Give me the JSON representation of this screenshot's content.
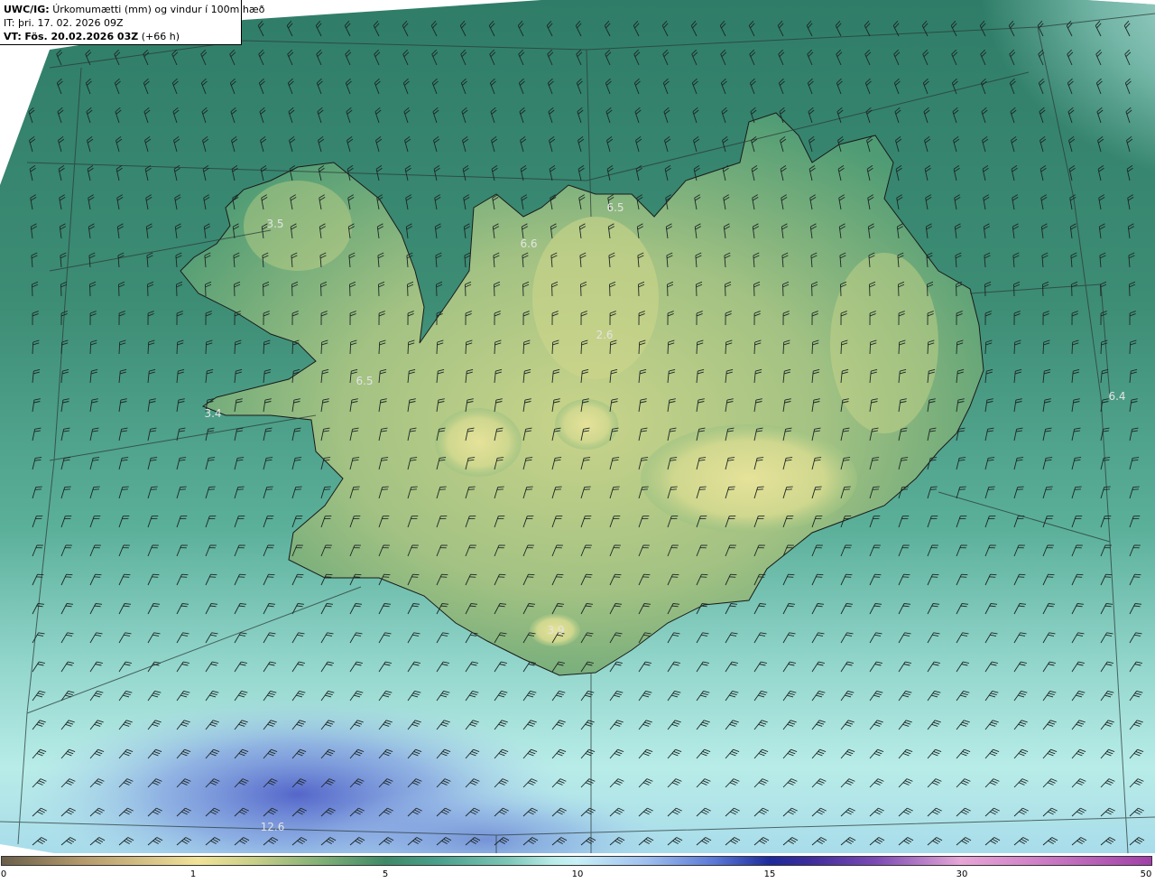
{
  "header": {
    "model": "UWC/IG:",
    "field": "Úrkomumætti (mm) og vindur í 100m hæð",
    "init_time": "IT: þri. 17. 02. 2026 09Z",
    "valid_prefix": "VT:",
    "valid_time": "Fös. 20.02.2026 03Z",
    "lead": "(+66 h)"
  },
  "map_labels": [
    {
      "text": "3.5",
      "id": "westfjords"
    },
    {
      "text": "6.6",
      "id": "north-west"
    },
    {
      "text": "6.5",
      "id": "north"
    },
    {
      "text": "2.6",
      "id": "central-north"
    },
    {
      "text": "6.5",
      "id": "west"
    },
    {
      "text": "3.4",
      "id": "snaefellsnes"
    },
    {
      "text": "6.4",
      "id": "east-sea"
    },
    {
      "text": "3.9",
      "id": "south"
    },
    {
      "text": "12.6",
      "id": "south-sea"
    }
  ],
  "colorbar": {
    "ticks": [
      "0",
      "1",
      "5",
      "10",
      "15",
      "30",
      "50"
    ]
  },
  "colors": {
    "land_high": "#d9dc8e",
    "land_mid": "#5fa77a",
    "sea": "#4f9e86",
    "sea_light": "#b6e8e4",
    "precip_heavy": "#5a6ad0",
    "coastline": "#1a1a1a"
  }
}
